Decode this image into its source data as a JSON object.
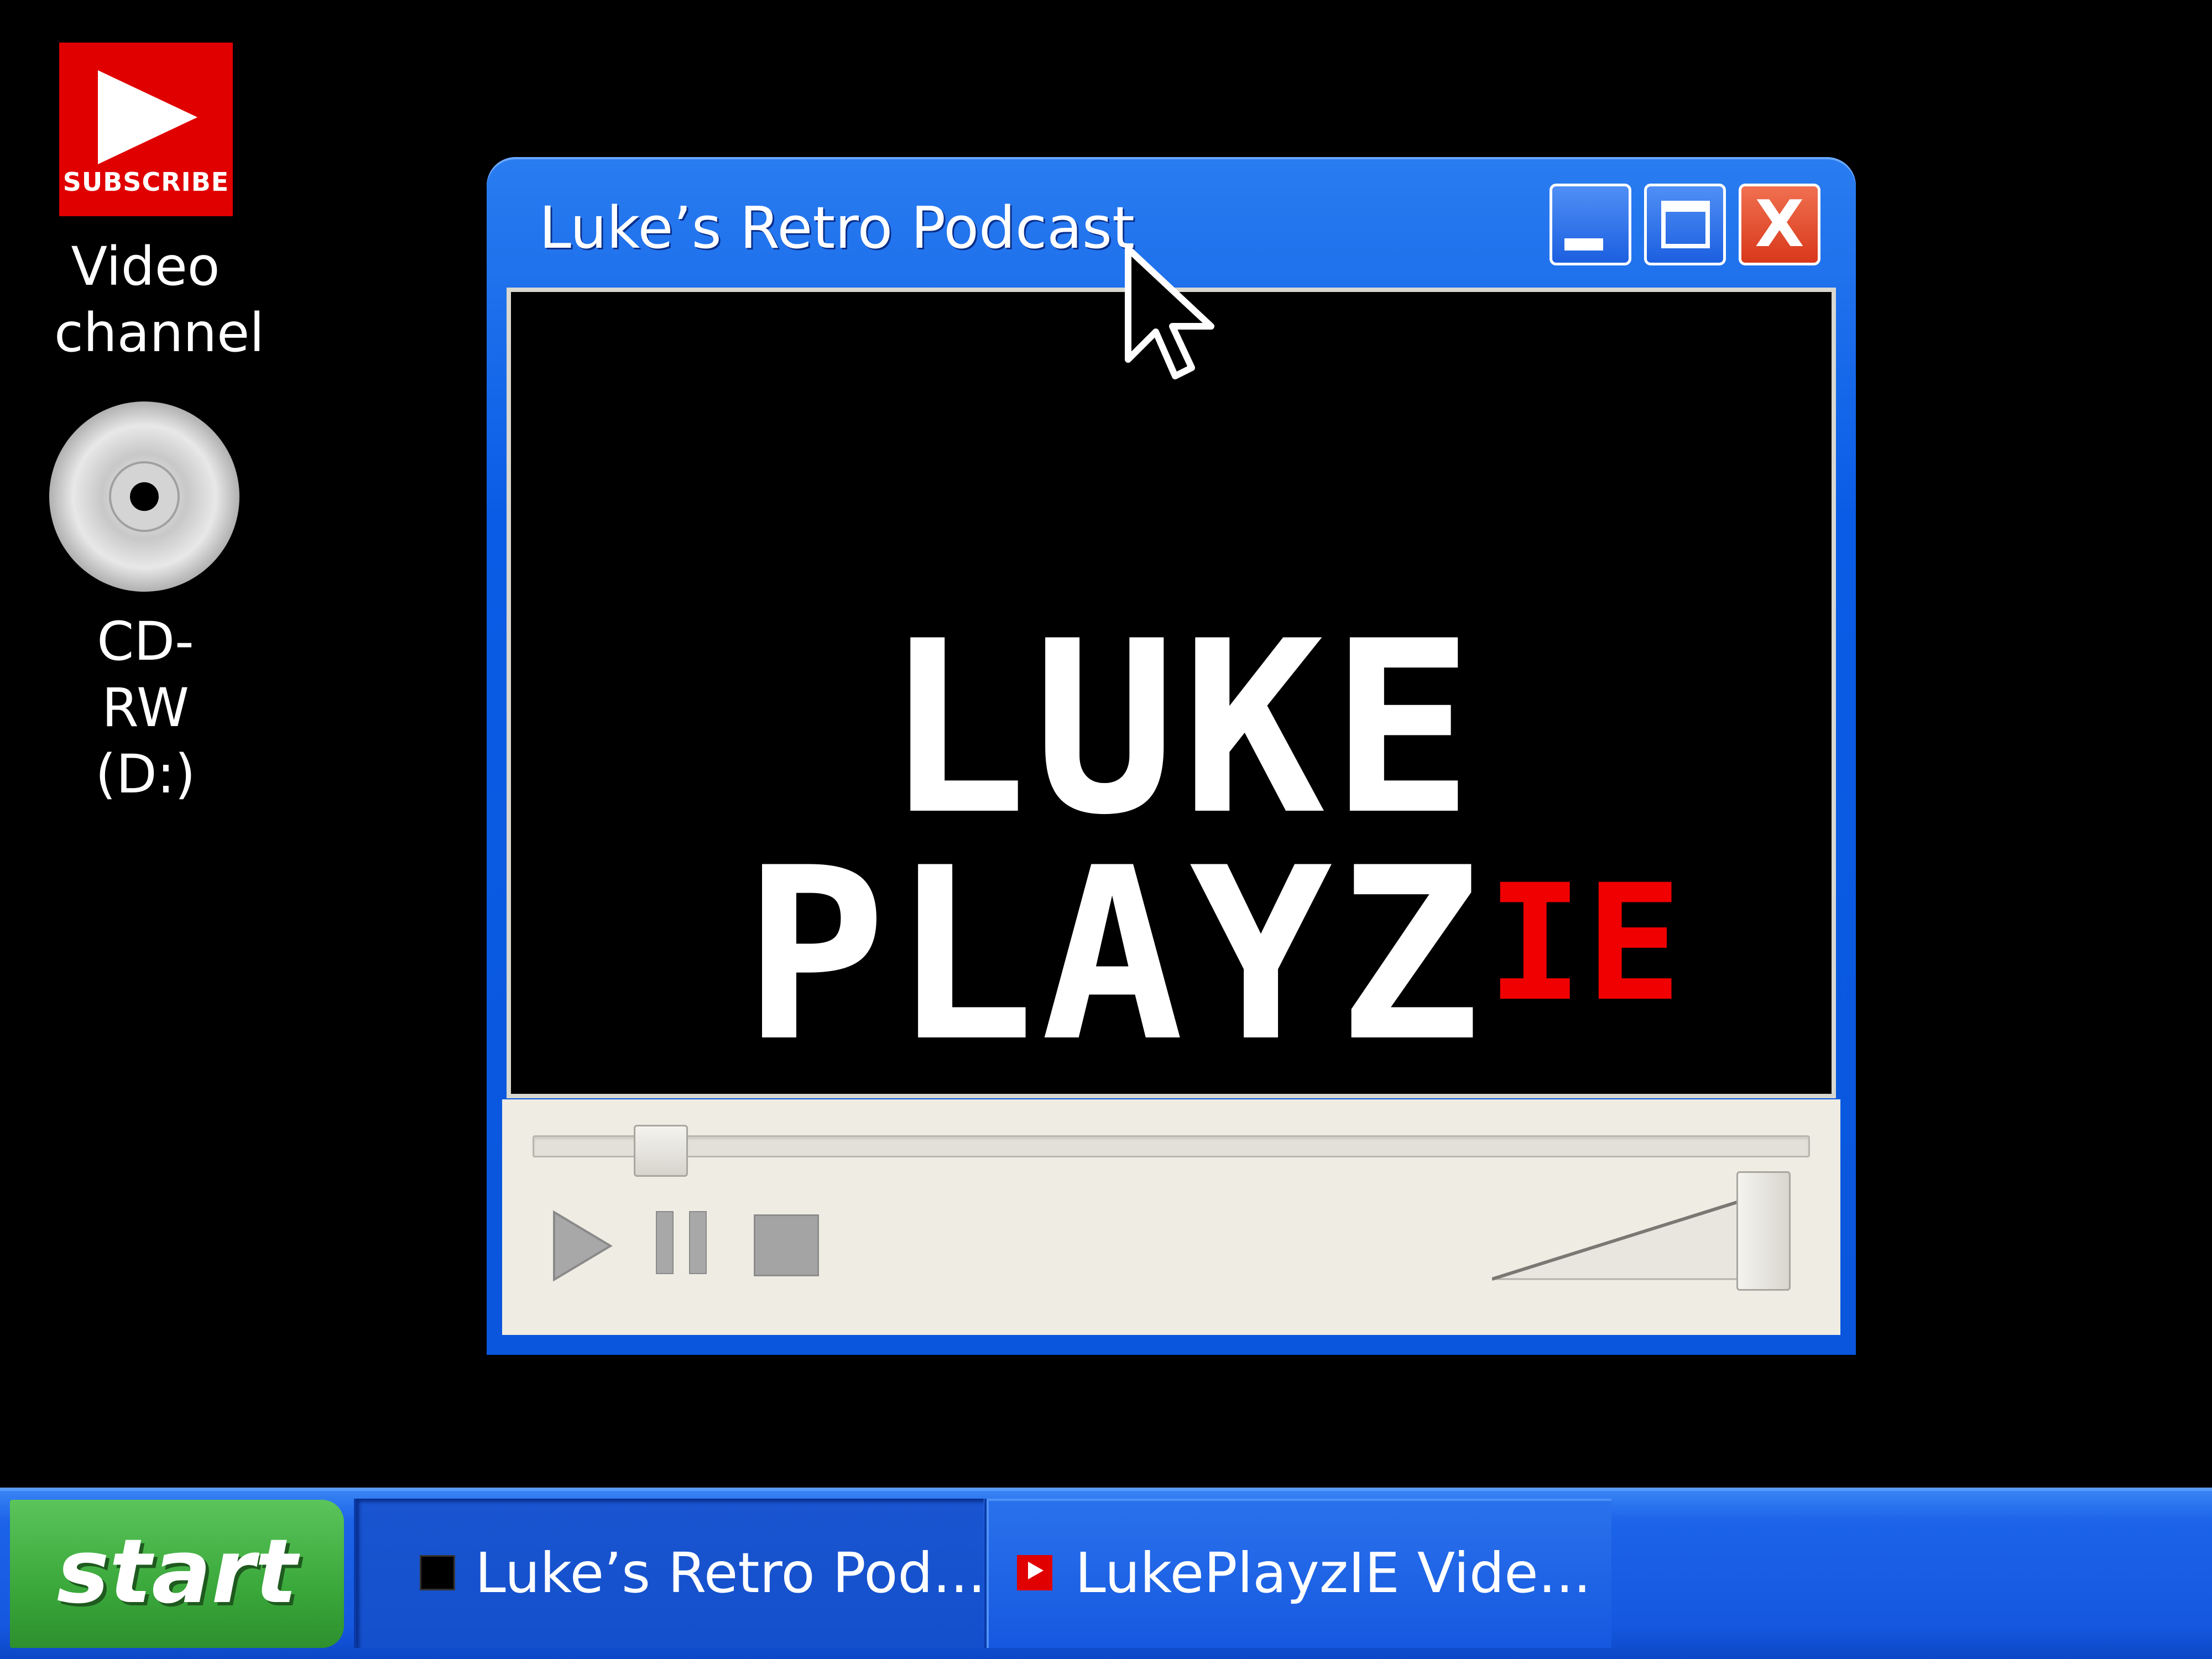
{
  "desktop": {
    "icons": [
      {
        "label": "Video\nchannel",
        "badge_text": "SUBSCRIBE",
        "icon": "youtube-subscribe-icon"
      },
      {
        "label": "CD-RW\n(D:)",
        "icon": "cd-disc-icon"
      }
    ]
  },
  "window": {
    "title": "Luke’s Retro Podcast",
    "close_glyph": "X",
    "logo": {
      "line1": "LUKE",
      "line2_main": "PLAYZ",
      "line2_accent": "IE"
    },
    "player": {
      "progress": 0.07,
      "volume": 1.0
    }
  },
  "taskbar": {
    "start_label": "start",
    "tasks": [
      {
        "label": "Luke’s Retro Pod...",
        "icon": "podcast-thumbnail-icon",
        "active": true
      },
      {
        "label": "LukePlayzIE Vide...",
        "icon": "youtube-icon",
        "active": false
      }
    ]
  },
  "colors": {
    "window_blue": "#0a5ce6",
    "close_red": "#e0401f",
    "start_green": "#3aa83a",
    "accent_red": "#f00000",
    "subscribe_red": "#e00000"
  }
}
